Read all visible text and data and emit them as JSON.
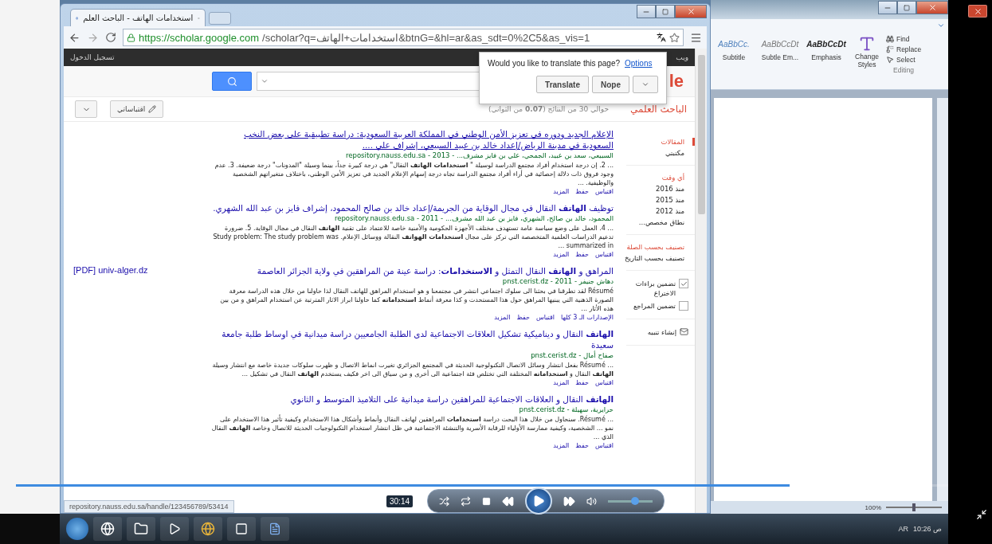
{
  "chrome": {
    "tab_title": "استخدامات الهاتف - الباحث العلم",
    "url_host": "https://scholar.google.com",
    "url_path": "/scholar?q=استخدامات+الهاتف&btnG=&hl=ar&as_sdt=0%2C5&as_vis=1",
    "signin": "تسجيل الدخول",
    "web_link": "ويب",
    "logo_fragment": "le",
    "status_url": "repository.nauss.edu.sa/handle/123456789/53414",
    "translate_popup": {
      "question": "Would you like to translate this page?",
      "options_link": "Options",
      "translate_button": "Translate",
      "nope_button": "Nope"
    }
  },
  "scholar": {
    "brand": "الباحث العلمي",
    "result_count": "حوالي 30 من النتائج (**0.07** من الثواني)",
    "my_citations": "اقتباساتي",
    "sidebar": [
      {
        "kind": "section",
        "items": [
          {
            "label": "المقالات",
            "selected": true
          },
          {
            "label": "مكتبتي",
            "selected": false
          }
        ]
      },
      {
        "kind": "filter",
        "items": [
          {
            "label": "أي وقت",
            "selected": true
          },
          {
            "label": "منذ 2016",
            "selected": false
          },
          {
            "label": "منذ 2015",
            "selected": false
          },
          {
            "label": "منذ 2012",
            "selected": false
          },
          {
            "label": "نطاق مخصص...",
            "selected": false
          }
        ]
      },
      {
        "kind": "filter",
        "items": [
          {
            "label": "تصنيف بحسب الصلة",
            "selected": true
          },
          {
            "label": "تصنيف بحسب التاريخ",
            "selected": false
          }
        ]
      },
      {
        "kind": "checks",
        "items": [
          {
            "label": "تضمين براءات الاختراع",
            "checked": true
          },
          {
            "label": "تضمين المراجع",
            "checked": false
          }
        ]
      },
      {
        "kind": "alert",
        "items": [
          {
            "label": "إنشاء تنبيه"
          }
        ]
      }
    ],
    "results": [
      {
        "hovered": true,
        "title": "الإعلام الجديد ودوره في تعزيز الأمن الوطني في المملكة العربية السعودية: دراسة تطبيقية على بعض النخب السعودية في مدينة الرياض/إعداد خالد بن عبيد السبيعي، إشراف علي ....",
        "meta": "السبيعي، سعد بن عبيد، الجمحي، علي بن فايز مشرف... - 2013 - repository.nauss.edu.sa",
        "snippet": "... 2. إن درجة استخدام أفراد مجتمع الدراسة لوسيلة \" **استخدامات الهاتف** النقال\" هي درجة كبيرة جداً، بينما وسيلة \"المدونات\" درجة ضعيفة. 3. عدم وجود فروق ذات دلالة إحصائية في أراء أفراد مجتمع الدراسة تجاه درجة إسهام الإعلام الجديد في تعزيز الأمن الوطني، باختلاف متغيراتهم الشخصية والوظيفية. ...",
        "links": [
          "اقتباس",
          "حفظ",
          "المزيد"
        ]
      },
      {
        "hovered": false,
        "title": "توظيف **الهاتف** النقال في مجال الوقاية من الجريمة/إعداد خالد بن صالح المحمود، إشراف فايز بن عبد الله الشهري.",
        "meta": "المحمود، خالد بن صالح، الشهري، فايز بن عبد الله مشرف... - 2011 - repository.nauss.edu.sa",
        "snippet": "... 4. العمل على وضع سياسة عامة تستهدف مختلف الأجهزة الحكومية والأمنية خاصة للاعتماد على تقنية **الهاتف** النقال في مجال الوقاية. 5. ضرورة تدعيم الدراسات العلمية المتخصصة التي تركز على مجال **استخدامات** **الهواتف** النقالة ووسائل الإعلام. Study problem: The study problem was summarized in ...",
        "links": [
          "اقتباس",
          "حفظ",
          "المزيد"
        ]
      },
      {
        "hovered": false,
        "side_link": "[PDF] univ-alger.dz",
        "title": "المراهق و **الهاتف** النقال التمثل و **الاستخدامات**: دراسة عينة من المراهقين في ولاية الجزائر العاصمة",
        "meta": "دهاش جنيفر - 2011 - pnst.cerist.dz",
        "snippet": "Résumé لقد تطرقنا في بحثنا الى سلوك اجتماعي انتشر في مجتمعنا و هو استخدام المراهق للهاتف النقال لذا حاولنا من خلال هذه الدراسة معرفة الصورة الذهنية التي يبنيها المراهق حول هذا المستحدث و كذا معرفة أنماط **استخداماته** كما حاولنا ابراز الاثار المترتبة عن استخدام المراهق و من بين هذه الأثار ...",
        "links": [
          "الإصدارات الـ 3 كلها",
          "اقتباس",
          "حفظ",
          "المزيد"
        ]
      },
      {
        "hovered": false,
        "title": "**الهاتف** النقال و ديناميكية تشكيل العلاقات الاجتماعية لدى الطلبة الجامعيين دراسة ميدانية في اوساط طلبة جامعة سعيدة",
        "meta": "صفاح أمال - pnst.cerist.dz",
        "snippet": "... Résumé بفعل انتشار وسائل الاتصال التكنولوجية الحديثة في المجتمع الجزائري تغيرت انماط الاتصال و ظهرت سلوكات جديدة خاصة مع انتشار وسيلة **الهاتف** النقال و **استخداماته** المختلفة التي تختلص فئة اجتماعية الى أخرى و من سياق الى اخر فكيف يستخدم **الهاتف** النقال في تشكيل ...",
        "links": [
          "اقتباس",
          "حفظ",
          "المزيد"
        ]
      },
      {
        "hovered": false,
        "title": "**الهاتف** النقال و العلاقات الاجتماعية للمراهقين دراسة ميدانية على التلاميذ المتوسط و الثانوي",
        "meta": "حرايرية، سهيلة - pnst.cerist.dz",
        "snippet": "... Résumé. سنحاول من خلال هذا البحث دراسة **استخدامات** المراهقين لهاتف النقال وأنماط وأشكال هذا الاستخدام وكيفية تأثير هذا الاستخدام على نمو ... الشخصية، وكيفية ممارسة الأولياء للرقابة الأسرية والتنشئة الاجتماعية في ظل انتشار استخدام التكنولوجيات الحديثة للاتصال وخاصة **الهاتف** النقال الذي ...",
        "links": [
          "اقتباس",
          "حفظ",
          "المزيد"
        ]
      }
    ]
  },
  "word": {
    "subtitle_style": {
      "sample": "AaBbCc.",
      "name": "Subtitle"
    },
    "subtle_emphasis_style": {
      "sample": "AaBbCcDt",
      "name": "Subtle Em..."
    },
    "emphasis_style": {
      "sample": "AaBbCcDt",
      "name": "Emphasis"
    },
    "change_styles": "Change Styles",
    "find": "Find",
    "replace": "Replace",
    "select": "Select",
    "group_label": "Editing",
    "zoom": "100%",
    "zoom_slider": {
      "level": 0.5
    }
  },
  "taskbar": {
    "language": "AR",
    "clock": "10:26 ص"
  },
  "player": {
    "time": "30:14",
    "progress": {
      "level": 0.83
    },
    "volume": {
      "level": 0.6
    }
  }
}
